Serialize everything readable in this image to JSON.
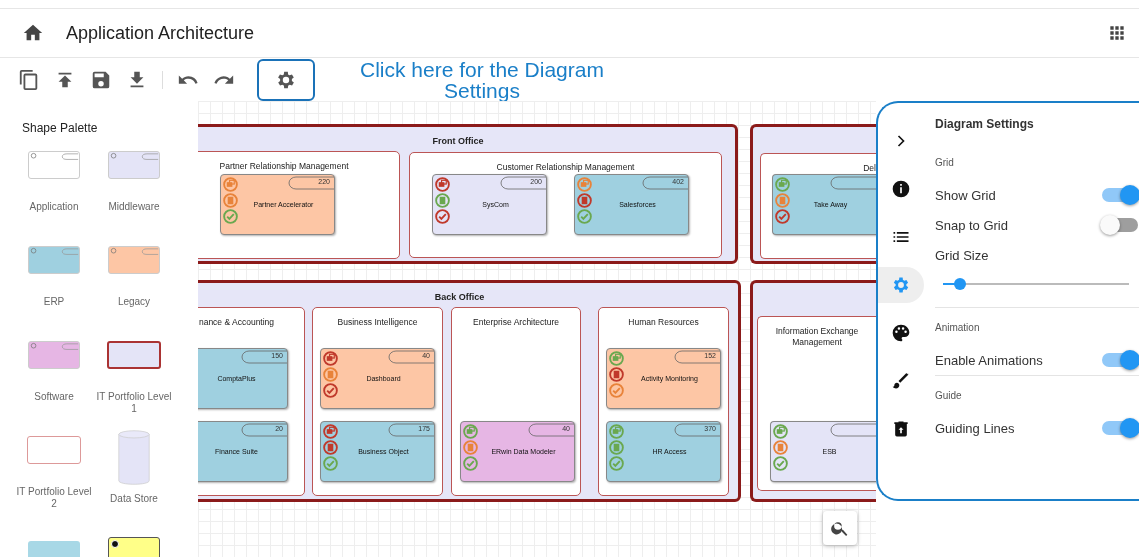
{
  "header": {
    "title": "Application Architecture"
  },
  "toolbar": {
    "callout": "Click here for the Diagram Settings"
  },
  "palette": {
    "title": "Shape Palette",
    "items": [
      {
        "label": "Application",
        "kind": "application"
      },
      {
        "label": "Middleware",
        "kind": "middleware"
      },
      {
        "label": "ERP",
        "kind": "erp"
      },
      {
        "label": "Legacy",
        "kind": "legacy"
      },
      {
        "label": "Software",
        "kind": "software"
      },
      {
        "label": "IT Portfolio Level 1",
        "kind": "level1"
      },
      {
        "label": "IT Portfolio Level 2",
        "kind": "level2"
      },
      {
        "label": "Data Store",
        "kind": "datastore"
      },
      {
        "kind": "plain"
      },
      {
        "kind": "note"
      }
    ]
  },
  "diagram": {
    "groups": [
      {
        "title": "Front Office",
        "domains": [
          {
            "title": "Partner Relationship Management",
            "apps": [
              {
                "name": "Partner Accelerator",
                "kind": "legacy",
                "badge": "220",
                "indicators": [
                  {
                    "color": "#e8833a"
                  },
                  {
                    "color": "#e8833a"
                  },
                  {
                    "color": "#6aa84f"
                  }
                ]
              }
            ]
          },
          {
            "title": "Customer Relationship Management",
            "apps": [
              {
                "name": "SysCom",
                "kind": "middleware",
                "badge": "200",
                "indicators": [
                  {
                    "color": "#c0392b"
                  },
                  {
                    "color": "#6aa84f"
                  },
                  {
                    "color": "#c0392b"
                  }
                ]
              },
              {
                "name": "Salesforces",
                "kind": "erp",
                "badge": "402",
                "indicators": [
                  {
                    "color": "#e8833a"
                  },
                  {
                    "color": "#c0392b"
                  },
                  {
                    "color": "#6aa84f"
                  }
                ]
              }
            ]
          }
        ]
      },
      {
        "title": "Back Office",
        "domains": [
          {
            "title": "nance & Accounting",
            "apps": [
              {
                "name": "ComptaPlus",
                "kind": "erp",
                "badge": "150"
              },
              {
                "name": "Finance Suite",
                "kind": "erp",
                "badge": "20"
              }
            ]
          },
          {
            "title": "Business Intelligence",
            "apps": [
              {
                "name": "Dashboard",
                "kind": "legacy",
                "badge": "40",
                "indicators": [
                  {
                    "color": "#c0392b"
                  },
                  {
                    "color": "#e8833a"
                  },
                  {
                    "color": "#c0392b"
                  }
                ]
              },
              {
                "name": "Business Object",
                "kind": "erp",
                "badge": "175",
                "indicators": [
                  {
                    "color": "#c0392b"
                  },
                  {
                    "color": "#c0392b"
                  },
                  {
                    "color": "#6aa84f"
                  }
                ]
              }
            ]
          },
          {
            "title": "Enterprise Architecture",
            "apps": [
              {
                "name": "ERwin Data Modeler",
                "kind": "software",
                "badge": "40",
                "indicators": [
                  {
                    "color": "#6aa84f"
                  },
                  {
                    "color": "#e8833a"
                  },
                  {
                    "color": "#6aa84f"
                  }
                ]
              }
            ]
          },
          {
            "title": "Human Resources",
            "apps": [
              {
                "name": "Activity Monitoring",
                "kind": "legacy",
                "badge": "152",
                "indicators": [
                  {
                    "color": "#6aa84f"
                  },
                  {
                    "color": "#c0392b"
                  },
                  {
                    "color": "#e8833a"
                  }
                ]
              },
              {
                "name": "HR Access",
                "kind": "erp",
                "badge": "370",
                "indicators": [
                  {
                    "color": "#6aa84f"
                  },
                  {
                    "color": "#6aa84f"
                  },
                  {
                    "color": "#6aa84f"
                  }
                ]
              }
            ]
          }
        ]
      },
      {
        "domains": [
          {
            "title": "Del",
            "apps": [
              {
                "name": "Take Away",
                "kind": "erp",
                "indicators": [
                  {
                    "color": "#6aa84f"
                  },
                  {
                    "color": "#e8833a"
                  },
                  {
                    "color": "#c0392b"
                  }
                ]
              }
            ]
          }
        ]
      },
      {
        "domains": [
          {
            "title": "Information Exchange Management",
            "apps": [
              {
                "name": "ESB",
                "kind": "middleware",
                "indicators": [
                  {
                    "color": "#6aa84f"
                  },
                  {
                    "color": "#e8833a"
                  },
                  {
                    "color": "#6aa84f"
                  }
                ]
              }
            ]
          }
        ]
      }
    ]
  },
  "settings": {
    "title": "Diagram Settings",
    "rail": [
      {
        "kind": "collapse",
        "selected": false
      },
      {
        "kind": "info",
        "selected": false
      },
      {
        "kind": "list",
        "selected": false
      },
      {
        "kind": "settings",
        "selected": true
      },
      {
        "kind": "palette",
        "selected": false
      },
      {
        "kind": "brush",
        "selected": false
      },
      {
        "kind": "trash",
        "selected": false
      }
    ],
    "sections": [
      {
        "title": "Grid",
        "rows": [
          {
            "kind": "toggle",
            "label": "Show Grid",
            "on": true
          },
          {
            "kind": "toggle",
            "label": "Snap to Grid",
            "on": false
          },
          {
            "kind": "slider",
            "label": "Grid Size",
            "level": 0.09
          }
        ]
      },
      {
        "title": "Animation",
        "rows": [
          {
            "kind": "toggle",
            "label": "Enable Animations",
            "on": true
          }
        ]
      },
      {
        "title": "Guide",
        "rows": [
          {
            "kind": "toggle",
            "label": "Guiding Lines",
            "on": true
          }
        ]
      }
    ]
  }
}
